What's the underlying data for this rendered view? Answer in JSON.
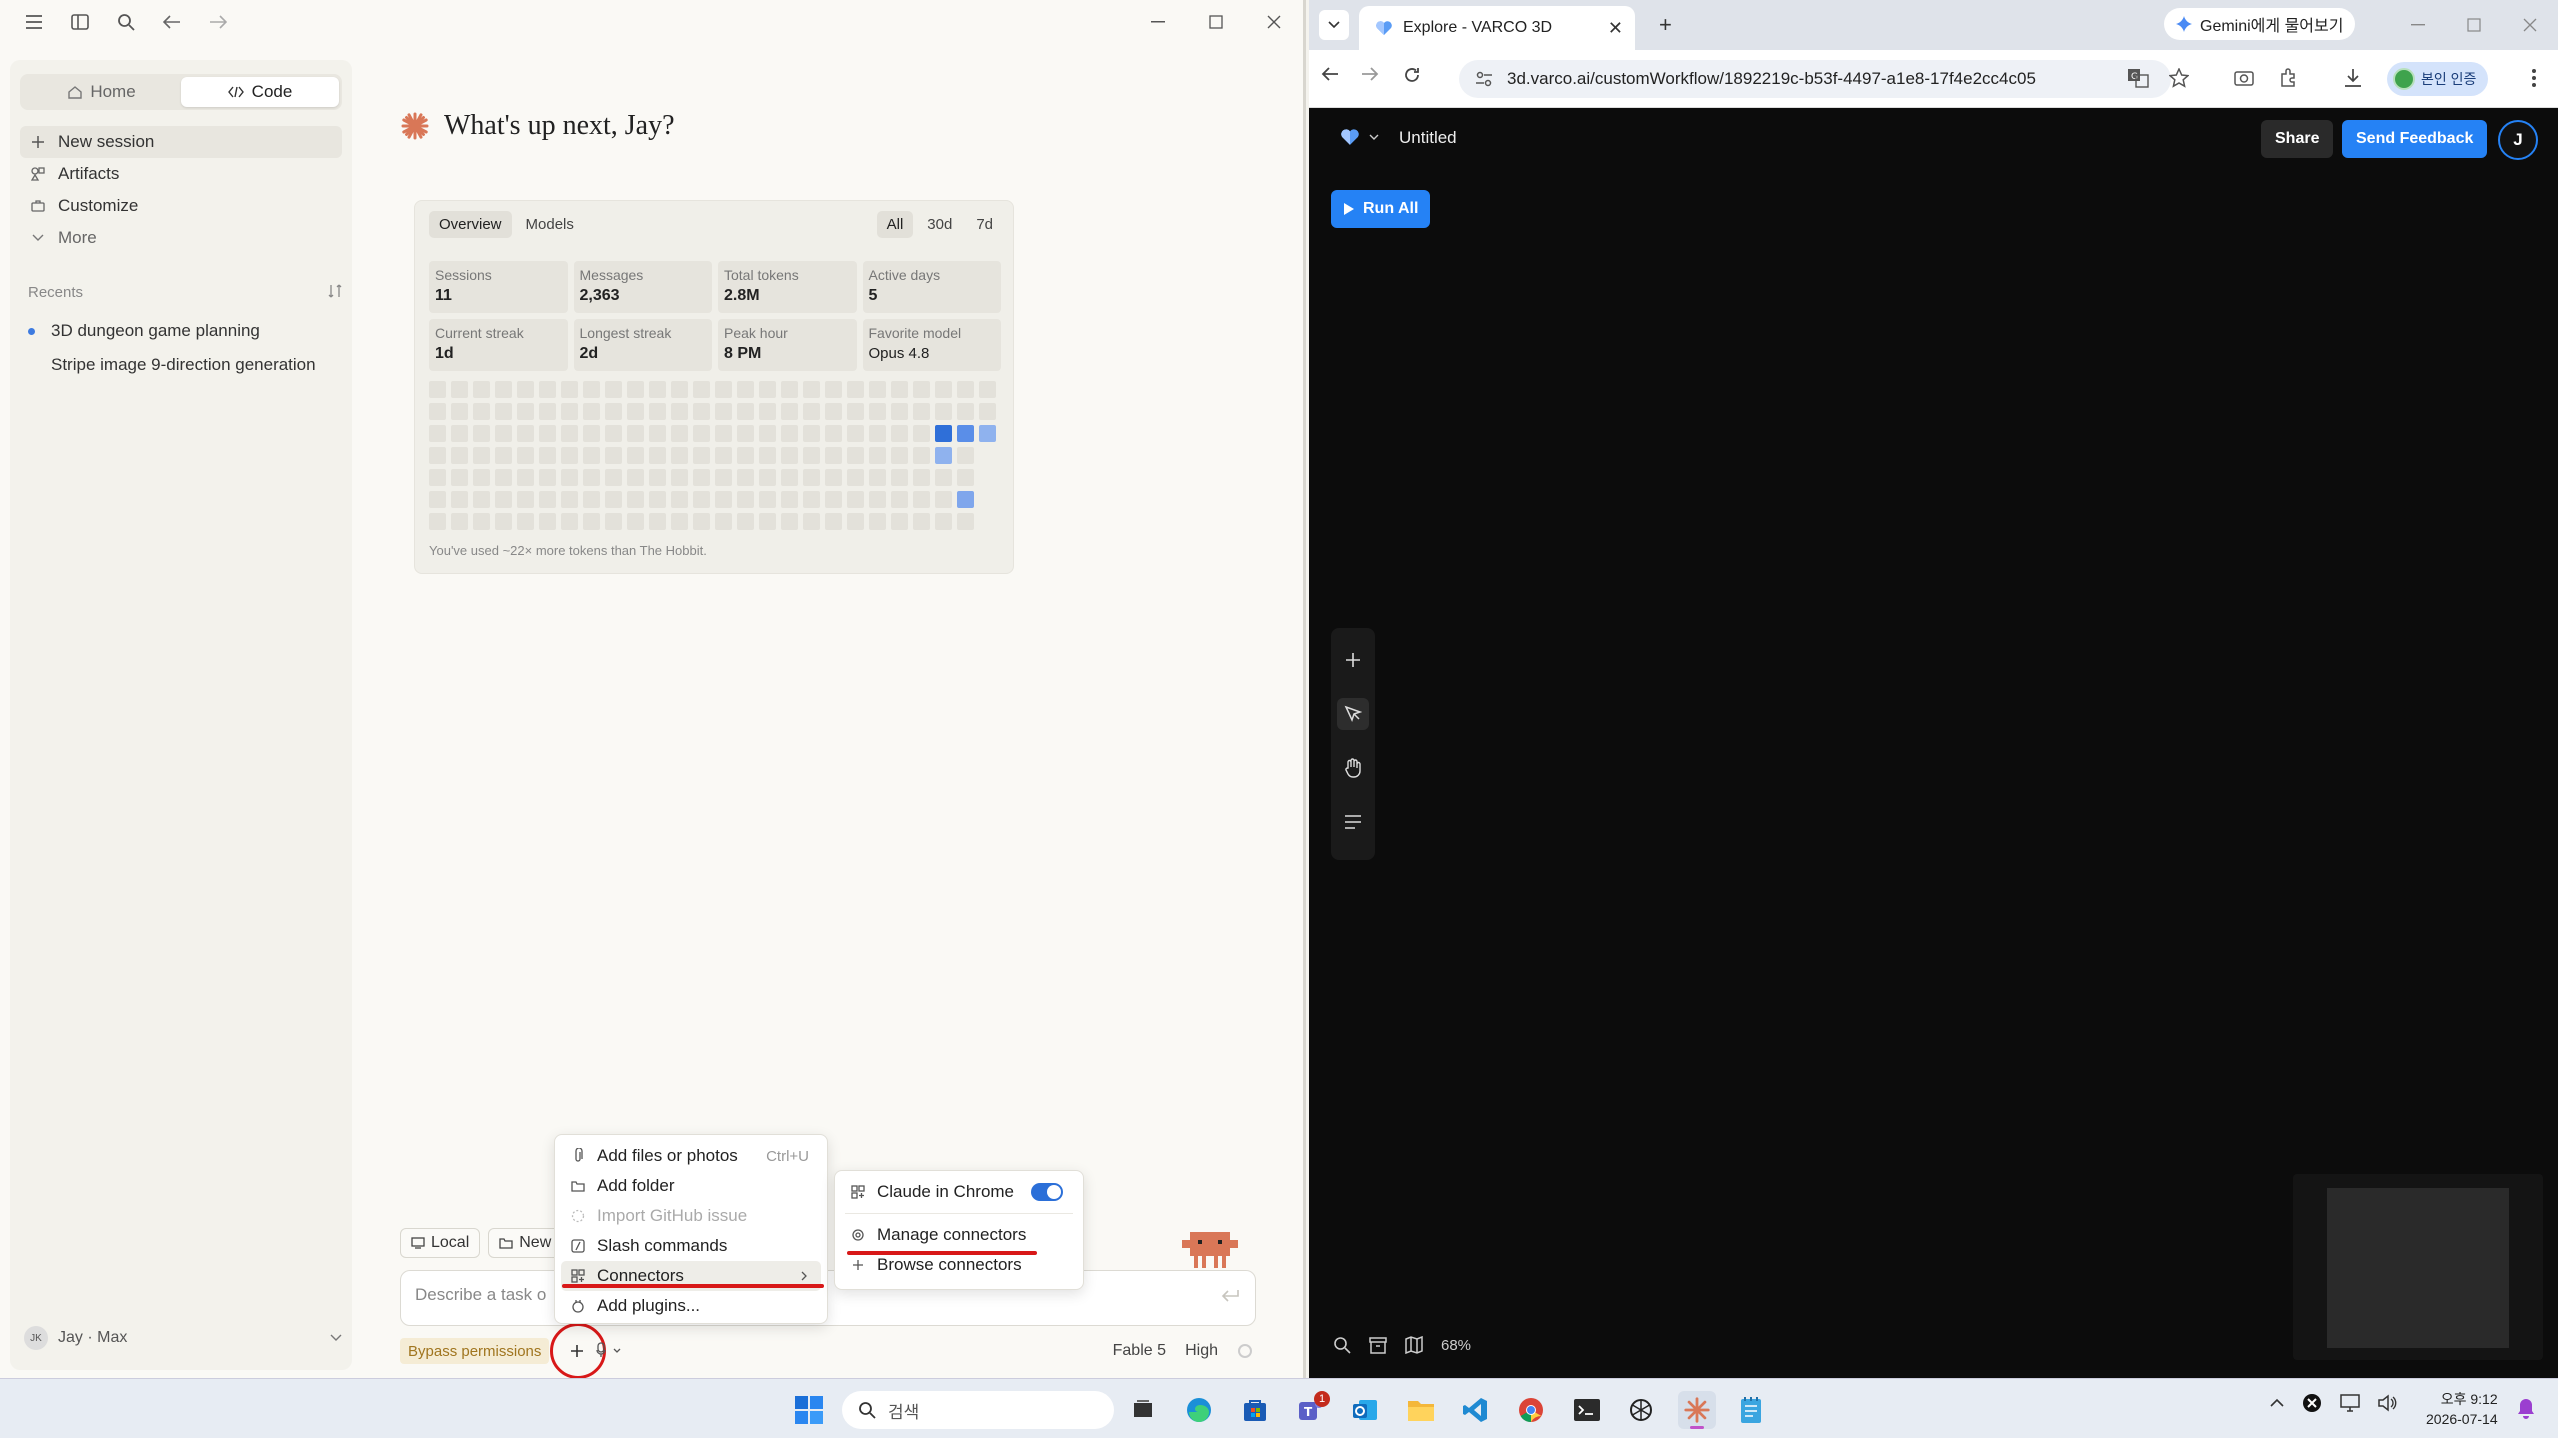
{
  "left_app": {
    "sidebar": {
      "tabs": [
        {
          "label": "Home"
        },
        {
          "label": "Code"
        }
      ],
      "nav": [
        {
          "label": "New session",
          "icon": "plus-icon"
        },
        {
          "label": "Artifacts",
          "icon": "artifacts-icon"
        },
        {
          "label": "Customize",
          "icon": "briefcase-icon"
        },
        {
          "label": "More",
          "icon": "chevron-down-icon"
        }
      ],
      "recents_label": "Recents",
      "recents": [
        {
          "label": "3D dungeon game planning",
          "active": true
        },
        {
          "label": "Stripe image 9-direction generation",
          "active": false
        }
      ],
      "user": {
        "initials": "JK",
        "label": "Jay · Max"
      }
    },
    "greeting": "What's up next, Jay?",
    "stats": {
      "tabs": [
        "Overview",
        "Models"
      ],
      "ranges": [
        "All",
        "30d",
        "7d"
      ],
      "cards": [
        {
          "label": "Sessions",
          "value": "11"
        },
        {
          "label": "Messages",
          "value": "2,363"
        },
        {
          "label": "Total tokens",
          "value": "2.8M"
        },
        {
          "label": "Active days",
          "value": "5"
        },
        {
          "label": "Current streak",
          "value": "1d"
        },
        {
          "label": "Longest streak",
          "value": "2d"
        },
        {
          "label": "Peak hour",
          "value": "8 PM"
        },
        {
          "label": "Favorite model",
          "value": "Opus 4.8"
        }
      ],
      "caption": "You've used ~22× more tokens than The Hobbit."
    },
    "composer": {
      "local_label": "Local",
      "new_label": "New",
      "placeholder": "Describe a task o",
      "bypass_label": "Bypass permissions",
      "model": "Fable 5",
      "effort": "High"
    },
    "plus_menu": [
      {
        "label": "Add files or photos",
        "shortcut": "Ctrl+U",
        "icon": "paperclip-icon"
      },
      {
        "label": "Add folder",
        "icon": "folder-icon"
      },
      {
        "label": "Import GitHub issue",
        "icon": "github-icon",
        "disabled": true
      },
      {
        "label": "Slash commands",
        "icon": "slash-icon"
      },
      {
        "label": "Connectors",
        "icon": "connectors-icon"
      },
      {
        "label": "Add plugins...",
        "icon": "plugin-icon"
      }
    ],
    "connectors_menu": [
      {
        "label": "Claude in Chrome",
        "toggle": true
      },
      {
        "label": "Manage connectors"
      },
      {
        "label": "Browse connectors"
      }
    ]
  },
  "browser": {
    "tab_title": "Explore - VARCO 3D",
    "gemini_label": "Gemini에게 물어보기",
    "url": "3d.varco.ai/customWorkflow/1892219c-b53f-4497-a1e8-17f4e2cc4c05",
    "verify_label": "본인 인증",
    "page": {
      "title": "Untitled",
      "share_label": "Share",
      "feedback_label": "Send Feedback",
      "avatar": "J",
      "run_label": "Run All",
      "zoom": "68%"
    }
  },
  "taskbar": {
    "search_placeholder": "검색",
    "time": "오후 9:12",
    "date": "2026-07-14",
    "teams_badge": "1"
  },
  "colors": {
    "accent_blue": "#2582f5",
    "claude_orange": "#d97757",
    "annotation_red": "#d81818"
  }
}
